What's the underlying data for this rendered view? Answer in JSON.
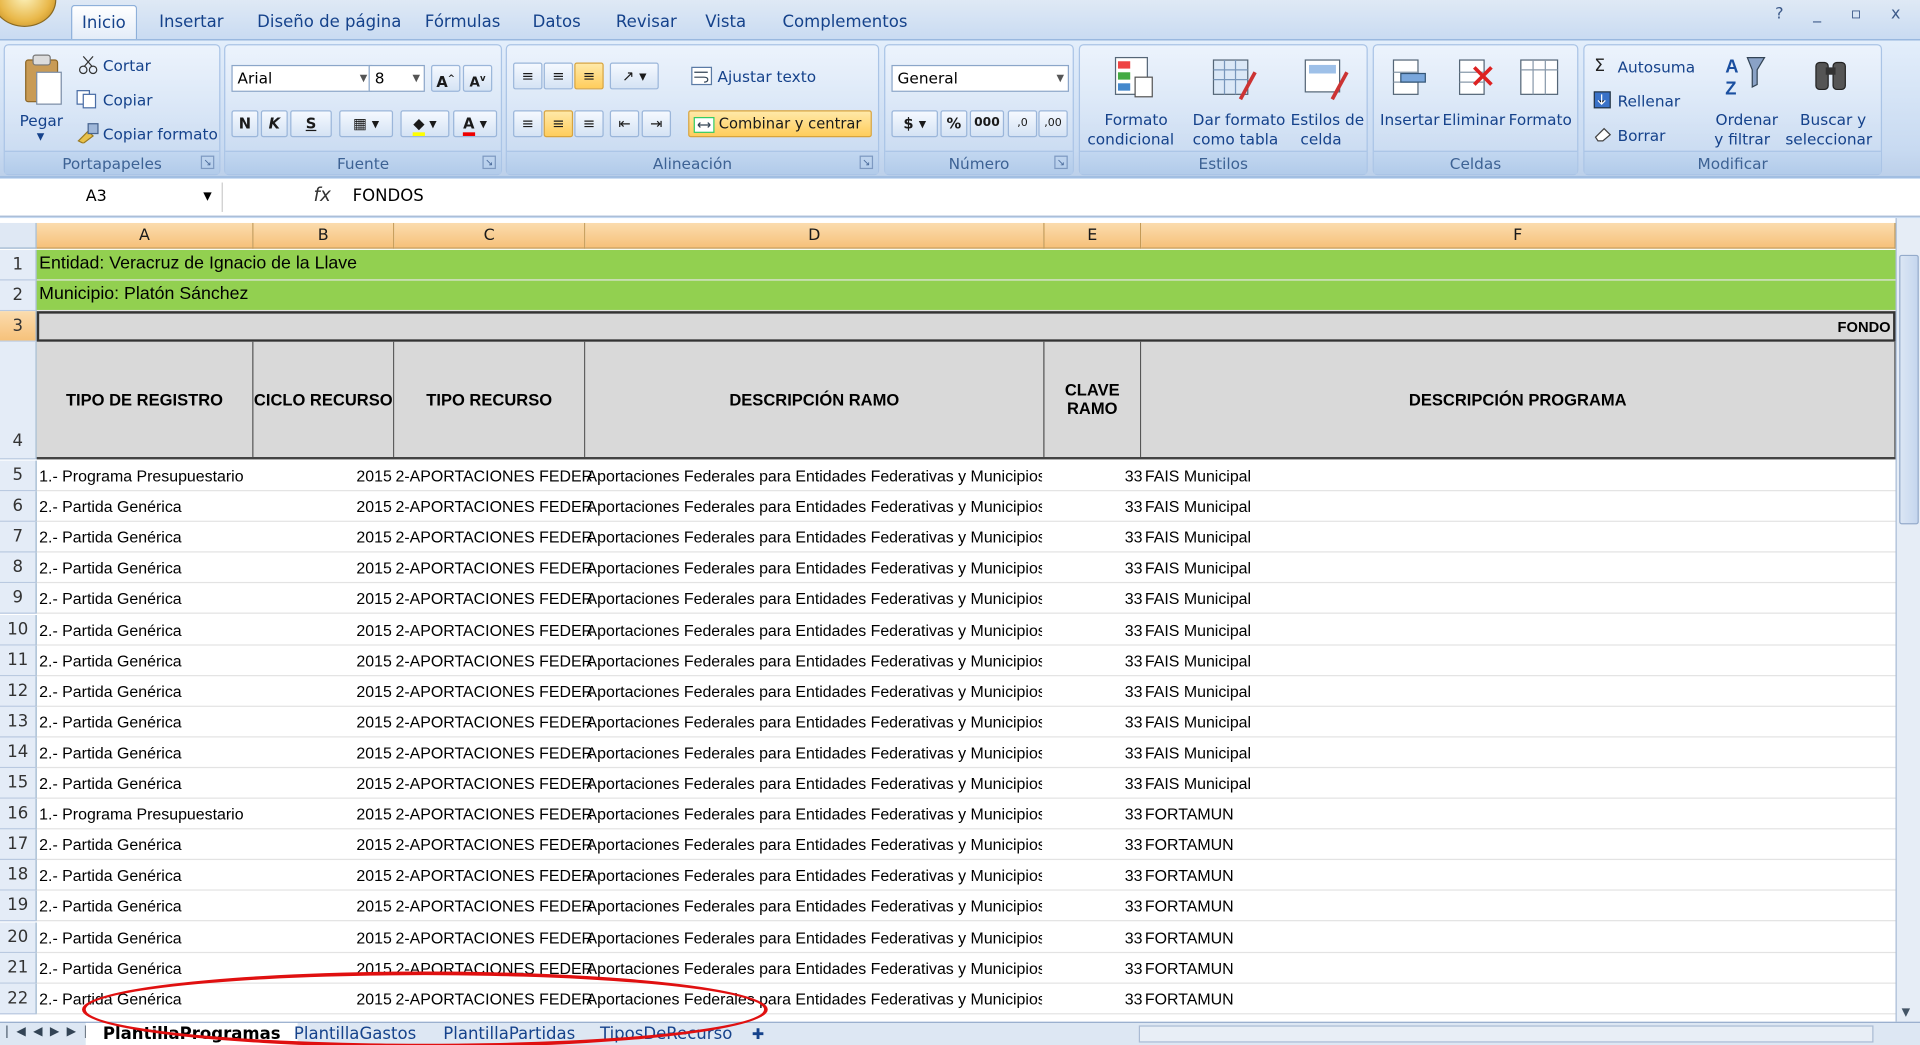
{
  "ribbon_tabs": [
    "Inicio",
    "Insertar",
    "Diseño de página",
    "Fórmulas",
    "Datos",
    "Revisar",
    "Vista",
    "Complementos"
  ],
  "window_controls": "? _ ▫ x",
  "clipboard": {
    "paste": "Pegar",
    "cut": "Cortar",
    "copy": "Copiar",
    "format_painter": "Copiar formato",
    "label": "Portapapeles"
  },
  "font": {
    "name": "Arial",
    "size": "8",
    "bold": "N",
    "italic": "K",
    "underline": "S",
    "label": "Fuente"
  },
  "alignment": {
    "wrap": "Ajustar texto",
    "merge": "Combinar y centrar",
    "label": "Alineación"
  },
  "number": {
    "format": "General",
    "currency": "$",
    "percent": "%",
    "thousands": "000",
    "label": "Número"
  },
  "styles": {
    "conditional": [
      "Formato",
      "condicional"
    ],
    "as_table": [
      "Dar formato",
      "como tabla"
    ],
    "cell_styles": [
      "Estilos de",
      "celda"
    ],
    "label": "Estilos"
  },
  "cells": {
    "insert": "Insertar",
    "delete": "Eliminar",
    "format": "Formato",
    "label": "Celdas"
  },
  "editing": {
    "autosum": "Autosuma",
    "fill": "Rellenar",
    "clear": "Borrar",
    "sort": [
      "Ordenar",
      "y filtrar"
    ],
    "find": [
      "Buscar y",
      "seleccionar"
    ],
    "label": "Modificar"
  },
  "formula_bar": {
    "name_box": "A3",
    "fx": "fx",
    "formula": "FONDOS"
  },
  "columns": [
    "A",
    "B",
    "C",
    "D",
    "E",
    "F"
  ],
  "title_rows": [
    {
      "num": "1",
      "text": "Entidad: Veracruz de Ignacio de la Llave"
    },
    {
      "num": "2",
      "text": "Municipio: Platón Sánchez"
    },
    {
      "num": "3",
      "text": "FONDO"
    }
  ],
  "header_row": {
    "num": "4",
    "cells": [
      "TIPO DE REGISTRO",
      "CICLO RECURSO",
      "TIPO RECURSO",
      "DESCRIPCIÓN RAMO",
      "CLAVE RAMO",
      "DESCRIPCIÓN PROGRAMA"
    ]
  },
  "rows": [
    {
      "num": "5",
      "tipo": "1.- Programa Presupuestario",
      "ciclo": "2015",
      "recurso": "2-APORTACIONES FEDERA",
      "ramo": "Aportaciones Federales para Entidades Federativas y Municipios",
      "clave": "33",
      "programa": "FAIS Municipal"
    },
    {
      "num": "6",
      "tipo": "2.- Partida Genérica",
      "ciclo": "2015",
      "recurso": "2-APORTACIONES FEDERA",
      "ramo": "Aportaciones Federales para Entidades Federativas y Municipios",
      "clave": "33",
      "programa": "FAIS Municipal"
    },
    {
      "num": "7",
      "tipo": "2.- Partida Genérica",
      "ciclo": "2015",
      "recurso": "2-APORTACIONES FEDERA",
      "ramo": "Aportaciones Federales para Entidades Federativas y Municipios",
      "clave": "33",
      "programa": "FAIS Municipal"
    },
    {
      "num": "8",
      "tipo": "2.- Partida Genérica",
      "ciclo": "2015",
      "recurso": "2-APORTACIONES FEDERA",
      "ramo": "Aportaciones Federales para Entidades Federativas y Municipios",
      "clave": "33",
      "programa": "FAIS Municipal"
    },
    {
      "num": "9",
      "tipo": "2.- Partida Genérica",
      "ciclo": "2015",
      "recurso": "2-APORTACIONES FEDERA",
      "ramo": "Aportaciones Federales para Entidades Federativas y Municipios",
      "clave": "33",
      "programa": "FAIS Municipal"
    },
    {
      "num": "10",
      "tipo": "2.- Partida Genérica",
      "ciclo": "2015",
      "recurso": "2-APORTACIONES FEDERA",
      "ramo": "Aportaciones Federales para Entidades Federativas y Municipios",
      "clave": "33",
      "programa": "FAIS Municipal"
    },
    {
      "num": "11",
      "tipo": "2.- Partida Genérica",
      "ciclo": "2015",
      "recurso": "2-APORTACIONES FEDERA",
      "ramo": "Aportaciones Federales para Entidades Federativas y Municipios",
      "clave": "33",
      "programa": "FAIS Municipal"
    },
    {
      "num": "12",
      "tipo": "2.- Partida Genérica",
      "ciclo": "2015",
      "recurso": "2-APORTACIONES FEDERA",
      "ramo": "Aportaciones Federales para Entidades Federativas y Municipios",
      "clave": "33",
      "programa": "FAIS Municipal"
    },
    {
      "num": "13",
      "tipo": "2.- Partida Genérica",
      "ciclo": "2015",
      "recurso": "2-APORTACIONES FEDERA",
      "ramo": "Aportaciones Federales para Entidades Federativas y Municipios",
      "clave": "33",
      "programa": "FAIS Municipal"
    },
    {
      "num": "14",
      "tipo": "2.- Partida Genérica",
      "ciclo": "2015",
      "recurso": "2-APORTACIONES FEDERA",
      "ramo": "Aportaciones Federales para Entidades Federativas y Municipios",
      "clave": "33",
      "programa": "FAIS Municipal"
    },
    {
      "num": "15",
      "tipo": "2.- Partida Genérica",
      "ciclo": "2015",
      "recurso": "2-APORTACIONES FEDERA",
      "ramo": "Aportaciones Federales para Entidades Federativas y Municipios",
      "clave": "33",
      "programa": "FAIS Municipal"
    },
    {
      "num": "16",
      "tipo": "1.- Programa Presupuestario",
      "ciclo": "2015",
      "recurso": "2-APORTACIONES FEDERA",
      "ramo": "Aportaciones Federales para Entidades Federativas y Municipios",
      "clave": "33",
      "programa": "FORTAMUN"
    },
    {
      "num": "17",
      "tipo": "2.- Partida Genérica",
      "ciclo": "2015",
      "recurso": "2-APORTACIONES FEDERA",
      "ramo": "Aportaciones Federales para Entidades Federativas y Municipios",
      "clave": "33",
      "programa": "FORTAMUN"
    },
    {
      "num": "18",
      "tipo": "2.- Partida Genérica",
      "ciclo": "2015",
      "recurso": "2-APORTACIONES FEDERA",
      "ramo": "Aportaciones Federales para Entidades Federativas y Municipios",
      "clave": "33",
      "programa": "FORTAMUN"
    },
    {
      "num": "19",
      "tipo": "2.- Partida Genérica",
      "ciclo": "2015",
      "recurso": "2-APORTACIONES FEDERA",
      "ramo": "Aportaciones Federales para Entidades Federativas y Municipios",
      "clave": "33",
      "programa": "FORTAMUN"
    },
    {
      "num": "20",
      "tipo": "2.- Partida Genérica",
      "ciclo": "2015",
      "recurso": "2-APORTACIONES FEDERA",
      "ramo": "Aportaciones Federales para Entidades Federativas y Municipios",
      "clave": "33",
      "programa": "FORTAMUN"
    },
    {
      "num": "21",
      "tipo": "2.- Partida Genérica",
      "ciclo": "2015",
      "recurso": "2-APORTACIONES FEDERA",
      "ramo": "Aportaciones Federales para Entidades Federativas y Municipios",
      "clave": "33",
      "programa": "FORTAMUN"
    },
    {
      "num": "22",
      "tipo": "2.- Partida Genérica",
      "ciclo": "2015",
      "recurso": "2-APORTACIONES FEDERA",
      "ramo": "Aportaciones Federales para Entidades Federativas y Municipios",
      "clave": "33",
      "programa": "FORTAMUN"
    }
  ],
  "sheet_tabs": [
    "PlantillaProgramas",
    "PlantillaGastos",
    "PlantillaPartidas",
    "TiposDeRecurso"
  ],
  "colors": {
    "title_fill": "#92d050",
    "header_fill": "#d9d9d9",
    "highlight_ellipse": "#e01010"
  }
}
